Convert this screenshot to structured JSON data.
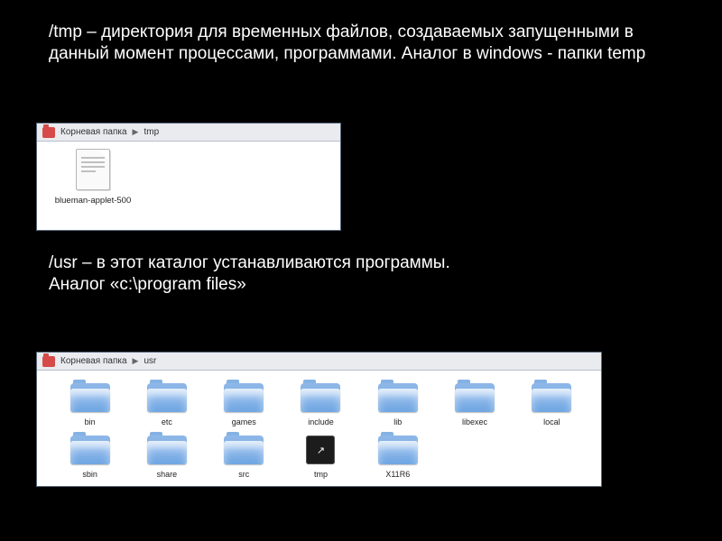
{
  "paragraphs": {
    "p1": " /tmp – директория для временных файлов, создаваемых запущенными в данный момент процессами, программами. Аналог в windows  -  папки  temp",
    "p2": " /usr – в этот каталог устанавливаются программы.\nАналог «c:\\program  files»"
  },
  "win_tmp": {
    "breadcrumb_root": "Корневая папка",
    "breadcrumb_leaf": "tmp",
    "file_label": "blueman-applet-500"
  },
  "win_usr": {
    "breadcrumb_root": "Корневая папка",
    "breadcrumb_leaf": "usr",
    "folders_row1": [
      "bin",
      "etc",
      "games",
      "include",
      "lib",
      "libexec",
      "local"
    ],
    "folders_row2": [
      "sbin",
      "share",
      "src",
      "tmp",
      "X11R6"
    ]
  }
}
